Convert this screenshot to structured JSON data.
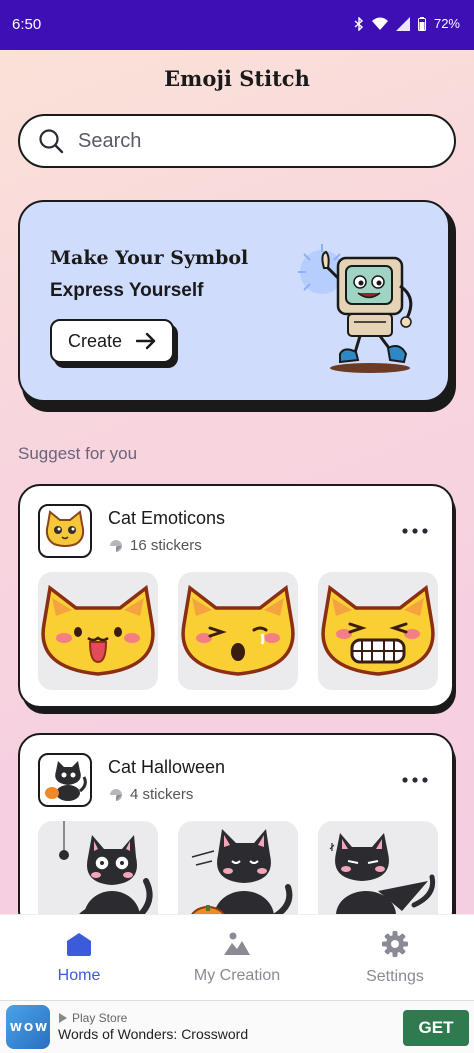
{
  "status_bar": {
    "time": "6:50",
    "battery": "72%"
  },
  "header": {
    "title": "Emoji Stitch"
  },
  "search": {
    "placeholder": "Search"
  },
  "banner": {
    "title": "Make Your Symbol",
    "subtitle": "Express Yourself",
    "button_label": "Create",
    "mascot_icon": "retro-computer-mascot-icon"
  },
  "suggest": {
    "label": "Suggest for you",
    "packs": [
      {
        "name": "Cat Emoticons",
        "count": "16 stickers",
        "stickers": [
          "cat-tongue-sticker",
          "cat-tear-sticker",
          "cat-grin-sticker"
        ]
      },
      {
        "name": "Cat Halloween",
        "count": "4 stickers",
        "stickers": [
          "cat-spider-sticker",
          "cat-pumpkin-sticker",
          "cat-witch-sticker"
        ]
      }
    ]
  },
  "bottom_nav": {
    "items": [
      {
        "label": "Home",
        "icon": "home-icon",
        "active": true
      },
      {
        "label": "My Creation",
        "icon": "gallery-icon",
        "active": false
      },
      {
        "label": "Settings",
        "icon": "gear-icon",
        "active": false
      }
    ]
  },
  "ad": {
    "store": "Play Store",
    "title": "Words of Wonders: Crossword",
    "button": "GET",
    "logo_text": "W O W"
  },
  "colors": {
    "accent": "#3b5bdb",
    "status_bar": "#3d0fb5",
    "banner_bg": "#cfdcfb",
    "ad_button": "#2f7a4e"
  }
}
